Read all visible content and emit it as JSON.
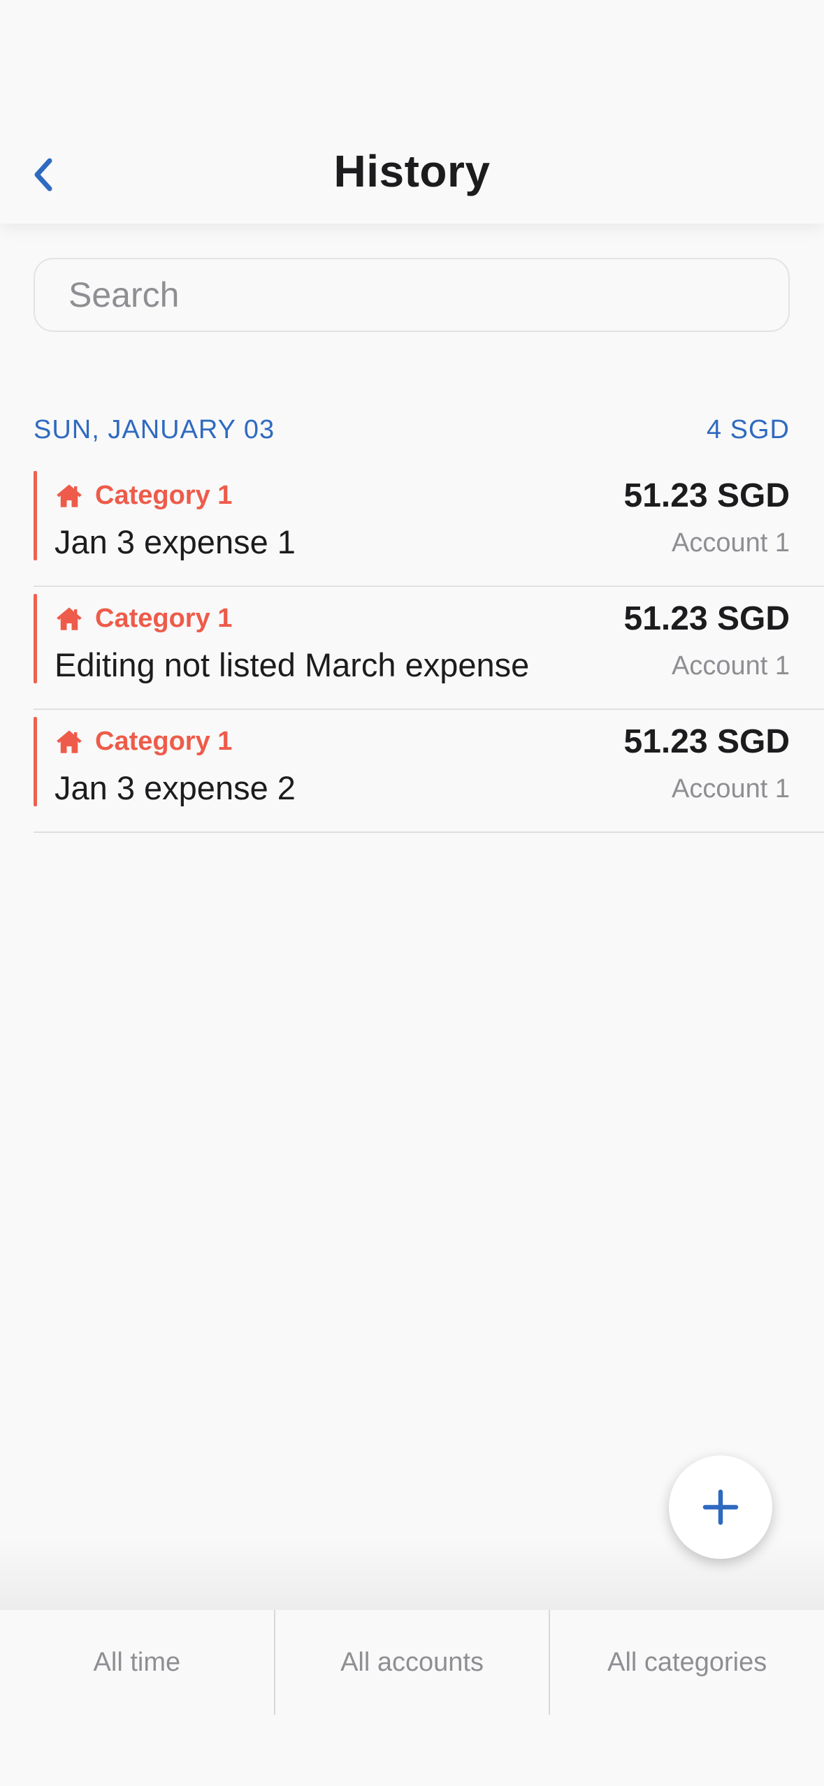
{
  "header": {
    "title": "History",
    "back_icon": "chevron-left-icon"
  },
  "search": {
    "placeholder": "Search",
    "value": ""
  },
  "colors": {
    "accent": "#2f6ac0",
    "category": "#ee5b4a",
    "text": "#1c1c1e",
    "secondary": "#8e8e93",
    "background": "#f9f9f9"
  },
  "section": {
    "date": "SUN, JANUARY 03",
    "total": "4 SGD"
  },
  "transactions": [
    {
      "category": "Category 1",
      "category_icon": "home-icon",
      "name": "Jan 3 expense 1",
      "amount": "51.23 SGD",
      "account": "Account 1"
    },
    {
      "category": "Category 1",
      "category_icon": "home-icon",
      "name": "Editing not listed March expense",
      "amount": "51.23 SGD",
      "account": "Account 1"
    },
    {
      "category": "Category 1",
      "category_icon": "home-icon",
      "name": "Jan 3 expense 2",
      "amount": "51.23 SGD",
      "account": "Account 1"
    }
  ],
  "fab": {
    "icon": "plus-icon"
  },
  "filters": {
    "time": "All time",
    "accounts": "All accounts",
    "categories": "All categories"
  }
}
